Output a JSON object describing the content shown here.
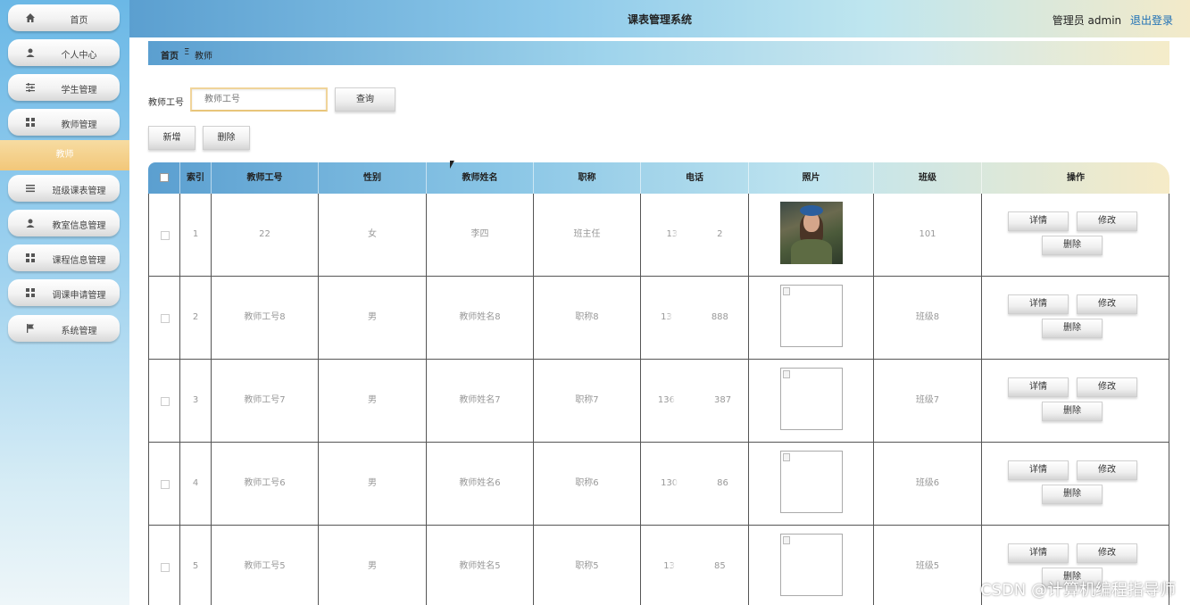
{
  "header": {
    "title": "课表管理系统",
    "user_label": "管理员 admin",
    "logout_label": "退出登录"
  },
  "sidebar": {
    "items": [
      {
        "label": "首页",
        "icon": "home-icon"
      },
      {
        "label": "个人中心",
        "icon": "user-icon"
      },
      {
        "label": "学生管理",
        "icon": "sliders-icon"
      },
      {
        "label": "教师管理",
        "icon": "grid-icon"
      },
      {
        "label": "教师",
        "icon": "",
        "active": true
      },
      {
        "label": "班级课表管理",
        "icon": "list-icon"
      },
      {
        "label": "教室信息管理",
        "icon": "user-icon"
      },
      {
        "label": "课程信息管理",
        "icon": "grid-icon"
      },
      {
        "label": "调课申请管理",
        "icon": "grid-icon"
      },
      {
        "label": "系统管理",
        "icon": "flag-icon"
      }
    ]
  },
  "breadcrumb": {
    "home": "首页",
    "separator": "Ξ",
    "current": "教师"
  },
  "search": {
    "label": "教师工号",
    "placeholder": "教师工号",
    "button": "查询"
  },
  "actions": {
    "add": "新增",
    "delete": "删除"
  },
  "table": {
    "columns": [
      "索引",
      "教师工号",
      "性别",
      "教师姓名",
      "职称",
      "电话",
      "照片",
      "班级",
      "操作"
    ],
    "row_actions": {
      "detail": "详情",
      "edit": "修改",
      "delete": "删除"
    },
    "rows": [
      {
        "index": "1",
        "teacher_id": "22",
        "gender": "女",
        "name": "李四",
        "title": "班主任",
        "phone_start": "13",
        "phone_end": "2",
        "photo": "real",
        "class": "101"
      },
      {
        "index": "2",
        "teacher_id": "教师工号8",
        "gender": "男",
        "name": "教师姓名8",
        "title": "职称8",
        "phone_start": "13",
        "phone_end": "888",
        "photo": "broken",
        "class": "班级8"
      },
      {
        "index": "3",
        "teacher_id": "教师工号7",
        "gender": "男",
        "name": "教师姓名7",
        "title": "职称7",
        "phone_start": "136",
        "phone_end": "387",
        "photo": "broken",
        "class": "班级7"
      },
      {
        "index": "4",
        "teacher_id": "教师工号6",
        "gender": "男",
        "name": "教师姓名6",
        "title": "职称6",
        "phone_start": "130",
        "phone_end": "86",
        "photo": "broken",
        "class": "班级6"
      },
      {
        "index": "5",
        "teacher_id": "教师工号5",
        "gender": "男",
        "name": "教师姓名5",
        "title": "职称5",
        "phone_start": "13",
        "phone_end": "85",
        "photo": "broken",
        "class": "班级5"
      }
    ]
  },
  "watermark": "CSDN @计算机编程指导师"
}
